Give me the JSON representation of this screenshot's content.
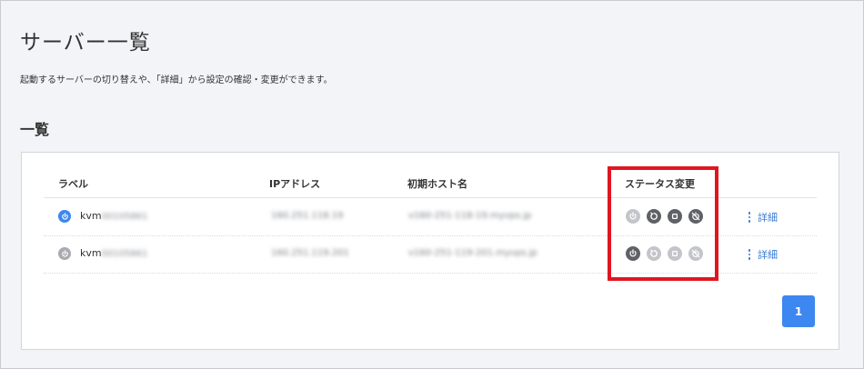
{
  "page": {
    "title": "サーバー一覧",
    "description": "起動するサーバーの切り替えや、「詳細」から設定の確認・変更ができます。",
    "section_title": "一覧"
  },
  "table": {
    "headers": {
      "label": "ラベル",
      "ip": "IPアドレス",
      "hostname": "初期ホスト名",
      "status_change": "ステータス変更"
    },
    "rows": [
      {
        "status": "running",
        "status_color": "#3d87f0",
        "label_prefix": "kvm",
        "label_masked": "00105861",
        "ip_masked": "160.251.118.19",
        "hostname_masked": "v160-251-118-19.myvps.jp",
        "actions": {
          "start": "disabled",
          "restart": "enabled",
          "stop": "enabled",
          "force_stop": "enabled"
        },
        "detail_label": "詳細"
      },
      {
        "status": "stopped",
        "status_color": "#a9abb0",
        "label_prefix": "kvm",
        "label_masked": "00105861",
        "ip_masked": "160.251.119.201",
        "hostname_masked": "v160-251-119-201.myvps.jp",
        "actions": {
          "start": "enabled",
          "restart": "disabled",
          "stop": "disabled",
          "force_stop": "disabled"
        },
        "detail_label": "詳細"
      }
    ]
  },
  "pagination": {
    "current_page": "1"
  },
  "icons": {
    "status": "power-icon",
    "start": "power-icon",
    "restart": "restart-icon",
    "stop": "stop-icon",
    "force_stop": "force-stop-icon",
    "detail": "kebab-menu-icon"
  },
  "colors": {
    "accent": "#3d87f0",
    "highlight": "#e0161f",
    "action_enabled": "#5f6166",
    "action_disabled": "#c3c5ca",
    "link": "#3a7bd5"
  }
}
